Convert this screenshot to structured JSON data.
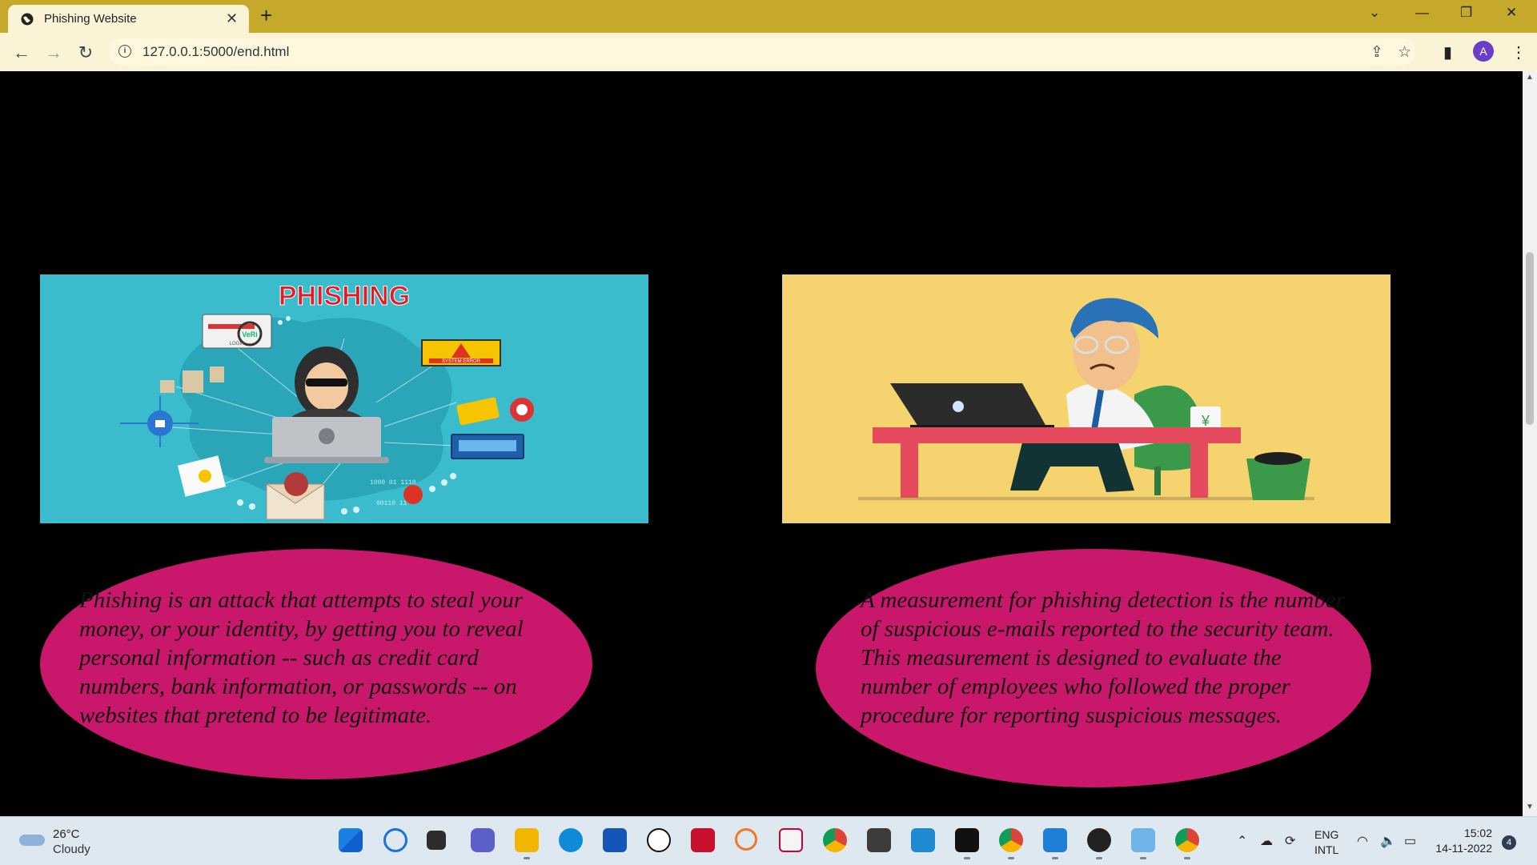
{
  "browser": {
    "tab_title": "Phishing Website",
    "tab_close": "✕",
    "new_tab": "+",
    "url": "127.0.0.1:5000/end.html",
    "profile_initial": "A"
  },
  "page": {
    "left_image": {
      "heading": "PHISHING",
      "labels": [
        "SYSTEM ERROR",
        "VeRi",
        "LOGIN"
      ]
    },
    "left_text": "Phishing is an attack that attempts to steal your money, or your identity, by getting you to reveal personal information -- such as credit card numbers, bank information, or passwords -- on websites that pretend to be legitimate.",
    "right_text": "A measurement for phishing detection is the number of suspicious e-mails reported to the security team. This measurement is designed to evaluate the number of employees who followed the proper procedure for reporting suspicious messages.",
    "colors": {
      "background": "#000000",
      "bubble": "#c9186c",
      "left_image_bg": "#3bbccd",
      "right_image_bg": "#f5d36e"
    }
  },
  "taskbar": {
    "weather_temp": "26°C",
    "weather_cond": "Cloudy",
    "lang_line1": "ENG",
    "lang_line2": "INTL",
    "time": "15:02",
    "date": "14-11-2022",
    "notifications": "4",
    "apps": [
      "start-icon",
      "search-icon",
      "task-view-icon",
      "chat-icon",
      "file-explorer-icon",
      "edge-icon",
      "store-icon",
      "dell-icon",
      "mcafee-icon",
      "jupyter-icon",
      "tool-icon",
      "chrome-icon",
      "terminal-icon",
      "vscode-icon",
      "cmd-icon",
      "chrome-profile-d-icon",
      "photos-icon",
      "media-player-icon",
      "remote-icon",
      "chrome-profile-a-icon"
    ]
  }
}
